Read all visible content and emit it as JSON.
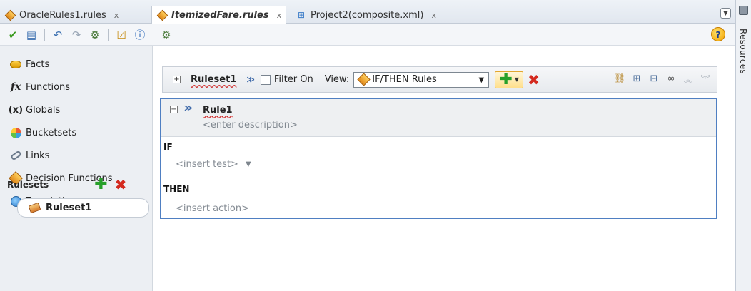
{
  "tabs": [
    {
      "label": "OracleRules1.rules",
      "close": "x",
      "active": false
    },
    {
      "label": "ItemizedFare.rules",
      "close": "x",
      "active": true
    },
    {
      "label": "Project2(composite.xml)",
      "close": "x",
      "active": false
    }
  ],
  "tab_menu_icon": "chevron-down-icon",
  "toolbar": {
    "icons": [
      "validate-check-icon",
      "book-icon",
      "undo-icon",
      "redo-icon",
      "deploy-icon",
      "report-icon",
      "info-icon",
      "compose-icon"
    ],
    "help": "?"
  },
  "resources_panel": {
    "label": "Resources"
  },
  "navigator": {
    "items": [
      {
        "label": "Facts",
        "icon": "facts-icon"
      },
      {
        "label": "Functions",
        "icon": "function-icon"
      },
      {
        "label": "Globals",
        "icon": "globals-icon"
      },
      {
        "label": "Bucketsets",
        "icon": "bucketset-icon"
      },
      {
        "label": "Links",
        "icon": "link-icon"
      },
      {
        "label": "Decision Functions",
        "icon": "decision-function-icon"
      },
      {
        "label": "Translations",
        "icon": "translation-icon"
      }
    ],
    "rulesets_label": "Rulesets",
    "rulesets": [
      {
        "label": "Ruleset1"
      }
    ]
  },
  "ruleset_bar": {
    "name": "Ruleset1",
    "filter_label": "Filter On",
    "filter_checked": false,
    "view_label": "View:",
    "view_value": "IF/THEN Rules"
  },
  "rule": {
    "name": "Rule1",
    "description_placeholder": "<enter description>",
    "if_label": "IF",
    "test_placeholder": "<insert test>",
    "then_label": "THEN",
    "action_placeholder": "<insert action>"
  },
  "colors": {
    "accent": "#4f7fc2",
    "add": "#27a02a",
    "delete": "#d42a1f"
  }
}
